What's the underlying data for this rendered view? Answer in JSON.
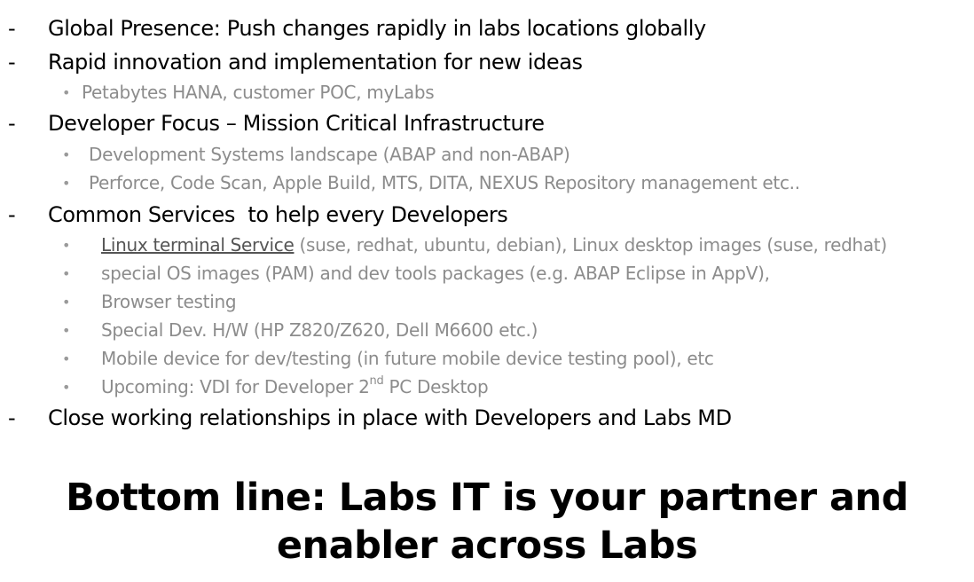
{
  "items": [
    {
      "dash": "-",
      "text": "Global Presence: Push changes rapidly in labs locations globally"
    },
    {
      "dash": "-",
      "text": "Rapid innovation and implementation for new ideas"
    },
    {
      "bullet": "•",
      "text": "Petabytes HANA, customer POC, myLabs"
    },
    {
      "dash": "-",
      "text": "Developer Focus – Mission Critical Infrastructure"
    },
    {
      "bullet": "•",
      "text": "Development Systems landscape (ABAP and non-ABAP)"
    },
    {
      "bullet": "•",
      "text": "Perforce, Code Scan, Apple Build, MTS, DITA, NEXUS Repository management etc.."
    },
    {
      "dash": "-",
      "text": "Common Services  to help every Developers"
    },
    {
      "bullet": "•",
      "link": "Linux terminal Service",
      "text": " (suse, redhat, ubuntu, debian), Linux desktop images (suse, redhat)"
    },
    {
      "bullet": "•",
      "text": "special OS images (PAM) and dev tools packages (e.g. ABAP Eclipse in AppV),"
    },
    {
      "bullet": "•",
      "text": "Browser testing"
    },
    {
      "bullet": "•",
      "text": "Special Dev. H/W (HP Z820/Z620, Dell M6600 etc.)"
    },
    {
      "bullet": "•",
      "text": "Mobile device for dev/testing (in future mobile device testing pool), etc"
    },
    {
      "bullet": "•",
      "text": "Upcoming: VDI for Developer 2",
      "sup": "nd",
      "text2": " PC Desktop"
    },
    {
      "dash": "-",
      "text": "Close working relationships in place with Developers and Labs MD"
    }
  ],
  "bottom_line": {
    "line1": "Bottom line: Labs IT is your partner and",
    "line2": "enabler across Labs"
  }
}
